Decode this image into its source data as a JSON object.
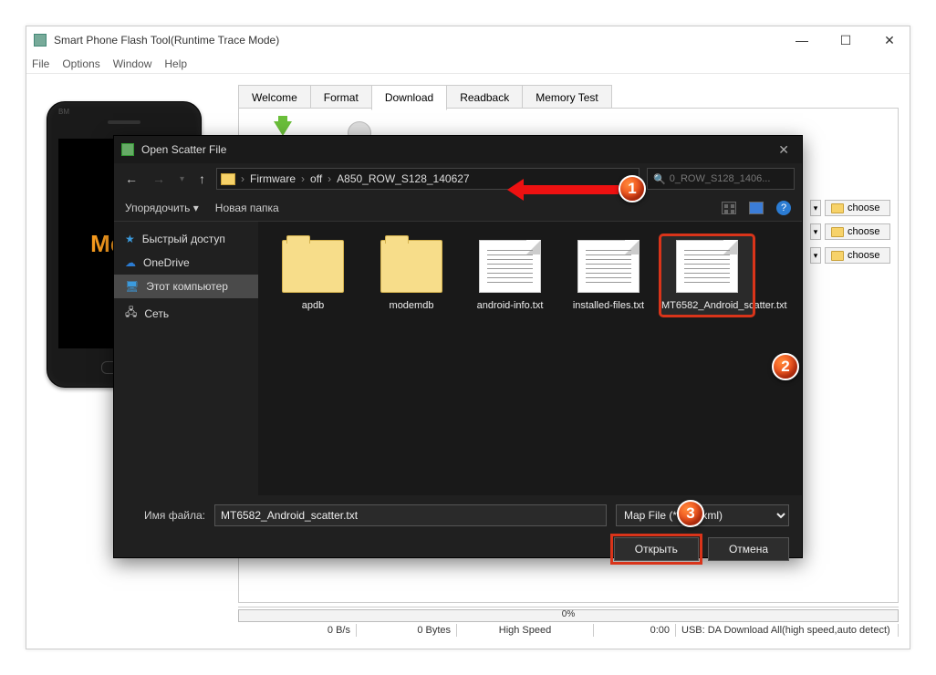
{
  "outer": {
    "title": "Smart Phone Flash Tool(Runtime Trace Mode)",
    "menu": {
      "file": "File",
      "options": "Options",
      "window": "Window",
      "help": "Help"
    }
  },
  "phone": {
    "brand": "Media",
    "bm": "BM"
  },
  "tabs": {
    "welcome": "Welcome",
    "format": "Format",
    "download": "Download",
    "readback": "Readback",
    "memtest": "Memory Test"
  },
  "toolbar": {
    "download": "Download",
    "stop": "Stop"
  },
  "choose": {
    "label": "choose"
  },
  "status": {
    "pct": "0%",
    "rate": "0 B/s",
    "bytes": "0 Bytes",
    "speed": "High Speed",
    "time": "0:00",
    "mode": "USB: DA Download All(high speed,auto detect)"
  },
  "dialog": {
    "title": "Open Scatter File",
    "crumbs": {
      "c1": "Firmware",
      "c2": "off",
      "c3": "A850_ROW_S128_140627"
    },
    "search_placeholder": "0_ROW_S128_1406...",
    "organize": "Упорядочить",
    "newfolder": "Новая папка",
    "sidebar": {
      "quick": "Быстрый доступ",
      "onedrive": "OneDrive",
      "thispc": "Этот компьютер",
      "network": "Сеть"
    },
    "files": {
      "f1": "apdb",
      "f2": "modemdb",
      "f3": "android-info.txt",
      "f4": "installed-files.txt",
      "f5": "MT6582_Android_scatter.txt"
    },
    "filename_label": "Имя файла:",
    "filename_value": "MT6582_Android_scatter.txt",
    "filter": "Map File (*.txt *.xml)",
    "open_btn": "Открыть",
    "cancel_btn": "Отмена"
  },
  "callouts": {
    "c1": "1",
    "c2": "2",
    "c3": "3"
  }
}
